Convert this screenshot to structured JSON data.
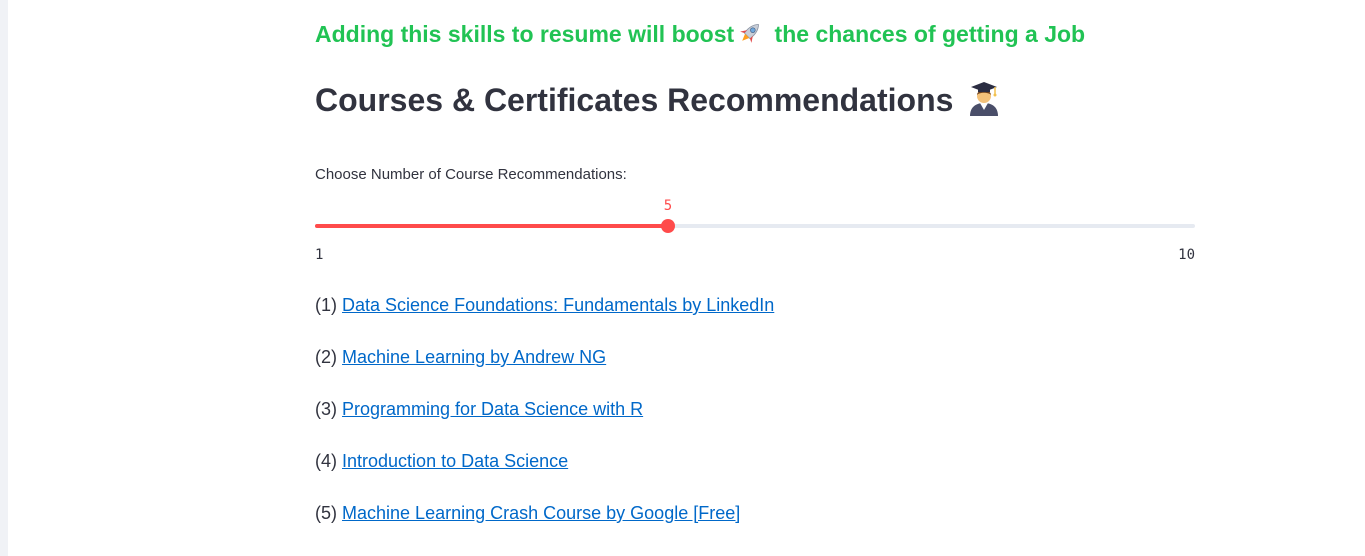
{
  "boost_message": {
    "before": "Adding this skills to resume will boost",
    "after": " the chances of getting a Job",
    "icon": "rocket-icon"
  },
  "section_heading": {
    "text": "Courses & Certificates Recommendations",
    "icon": "graduate-icon"
  },
  "slider": {
    "label": "Choose Number of Course Recommendations:",
    "value": 5,
    "min": 1,
    "max": 10,
    "min_label": "1",
    "max_label": "10",
    "value_label": "5",
    "accent_color": "#ff4b4b"
  },
  "courses": [
    {
      "index": "(1)",
      "title": "Data Science Foundations: Fundamentals by LinkedIn"
    },
    {
      "index": "(2)",
      "title": "Machine Learning by Andrew NG"
    },
    {
      "index": "(3)",
      "title": "Programming for Data Science with R"
    },
    {
      "index": "(4)",
      "title": "Introduction to Data Science"
    },
    {
      "index": "(5)",
      "title": "Machine Learning Crash Course by Google [Free]"
    }
  ],
  "colors": {
    "boost_text": "#21c354",
    "link": "#0068c9",
    "text": "#31333f"
  }
}
